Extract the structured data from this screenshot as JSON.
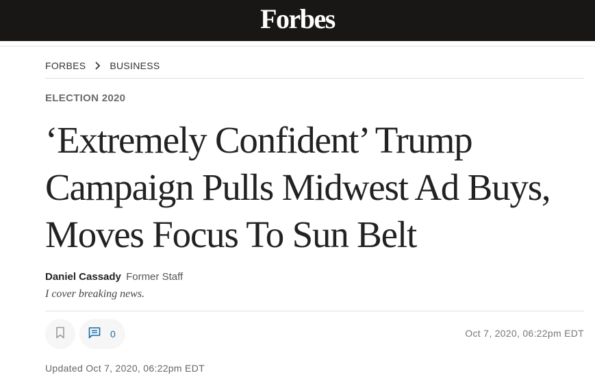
{
  "header": {
    "logo_text": "Forbes",
    "background": "#181716"
  },
  "breadcrumb": [
    {
      "label": "FORBES"
    },
    {
      "label": "BUSINESS"
    }
  ],
  "article": {
    "section": "ELECTION 2020",
    "headline": "‘Extremely Confident’ Trump Campaign Pulls Midwest Ad Buys, Moves Focus To Sun Belt",
    "author": {
      "name": "Daniel Cassady",
      "role": "Former Staff",
      "bio": "I cover breaking news."
    },
    "actions": {
      "bookmark_icon": "bookmark-icon",
      "comment_icon": "comment-icon",
      "comment_count": "0"
    },
    "published": "Oct 7, 2020, 06:22pm EDT",
    "updated": "Updated Oct 7, 2020, 06:22pm EDT"
  },
  "colors": {
    "accent": "#1469a8",
    "text": "#222222"
  }
}
